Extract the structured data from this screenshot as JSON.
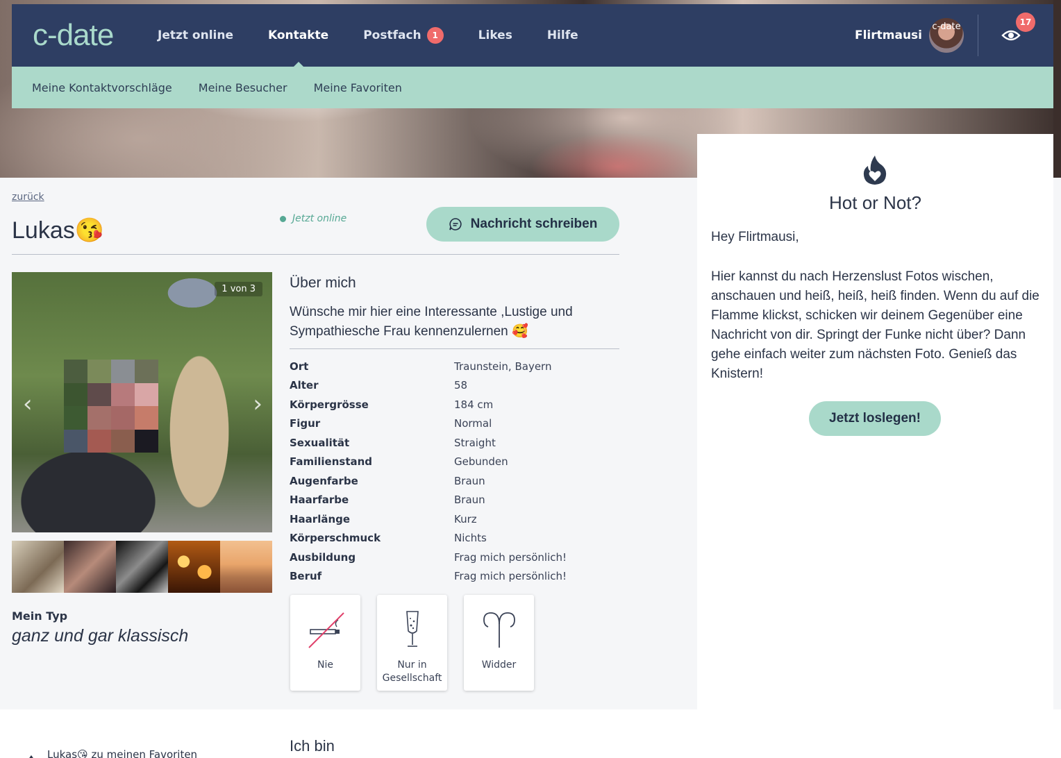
{
  "nav": {
    "logo": "c-date",
    "items": [
      {
        "label": "Jetzt online"
      },
      {
        "label": "Kontakte"
      },
      {
        "label": "Postfach",
        "badge": "1"
      },
      {
        "label": "Likes"
      },
      {
        "label": "Hilfe"
      }
    ],
    "username": "Flirtmausi",
    "avatar_text": "c-date",
    "eye_badge": "17",
    "icons": [
      "eye-icon"
    ]
  },
  "subnav": {
    "items": [
      "Meine Kontaktvorschläge",
      "Meine Besucher",
      "Meine Favoriten"
    ]
  },
  "profile": {
    "back": "zurück",
    "name": "Lukas",
    "name_emoji": "😘",
    "online": "Jetzt online",
    "message_button": "Nachricht schreiben",
    "photo_counter": "1 von 3",
    "arrow_left": "‹",
    "arrow_right": "›",
    "mytype_label": "Mein Typ",
    "mytype_value": "ganz und gar klassisch",
    "about_title": "Über mich",
    "about_text": "Wünsche mir hier eine Interessante ,Lustige und Sympathiesche Frau kennenzulernen 🥰",
    "attributes": [
      {
        "key": "Ort",
        "value": "Traunstein, Bayern"
      },
      {
        "key": "Alter",
        "value": "58"
      },
      {
        "key": "Körpergrösse",
        "value": "184 cm"
      },
      {
        "key": "Figur",
        "value": "Normal"
      },
      {
        "key": "Sexualität",
        "value": "Straight"
      },
      {
        "key": "Familienstand",
        "value": "Gebunden"
      },
      {
        "key": "Augenfarbe",
        "value": "Braun"
      },
      {
        "key": "Haarfarbe",
        "value": "Braun"
      },
      {
        "key": "Haarlänge",
        "value": "Kurz"
      },
      {
        "key": "Körperschmuck",
        "value": "Nichts"
      },
      {
        "key": "Ausbildung",
        "value": "Frag mich persönlich!"
      },
      {
        "key": "Beruf",
        "value": "Frag mich persönlich!"
      }
    ],
    "icon_cards": [
      {
        "label": "Nie",
        "icon": "no-smoking-icon"
      },
      {
        "label": "Nur in Gesellschaft",
        "icon": "champagne-glass-icon"
      },
      {
        "label": "Widder",
        "icon": "aries-icon"
      }
    ]
  },
  "hot": {
    "title": "Hot or Not?",
    "greeting": "Hey Flirtmausi,",
    "text": "Hier kannst du nach Herzenslust Fotos wischen, anschauen und heiß, heiß, heiß finden. Wenn du auf die Flamme klickst, schicken wir deinem Gegenüber eine Nachricht von dir. Springt der Funke nicht über? Dann gehe einfach weiter zum nächsten Foto. Genieß das Knistern!",
    "button": "Jetzt loslegen!"
  },
  "bottom": {
    "fav_name": "Lukas",
    "fav_emoji": "😘",
    "fav_text": "zu meinen Favoriten",
    "ichbin": "Ich bin"
  },
  "colors": {
    "nav_bg": "#2e3e63",
    "mint": "#a9d9ca",
    "badge": "#f06b6b",
    "online": "#56a894"
  }
}
